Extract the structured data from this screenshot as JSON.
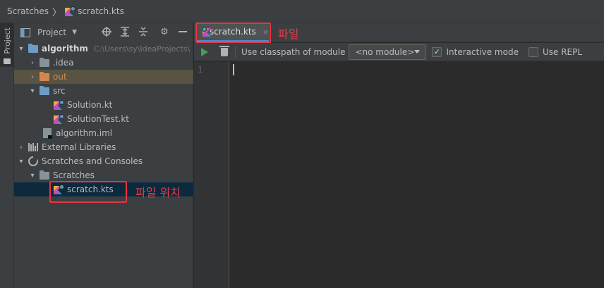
{
  "breadcrumb": {
    "root": "Scratches",
    "file": "scratch.kts"
  },
  "tool_strip": {
    "project_label": "Project"
  },
  "project_panel": {
    "title": "Project"
  },
  "tree": {
    "root_name": "algorithm",
    "root_path": "C:\\Users\\sy\\IdeaProjects\\",
    "idea": ".idea",
    "out": "out",
    "src": "src",
    "solution": "Solution.kt",
    "solution_test": "SolutionTest.kt",
    "iml": "algorithm.iml",
    "external_libraries": "External Libraries",
    "scratches_consoles": "Scratches and Consoles",
    "scratches": "Scratches",
    "scratch_file": "scratch.kts"
  },
  "editor_tab": {
    "label": "scratch.kts",
    "close": "×"
  },
  "scratch_toolbar": {
    "classpath_label": "Use classpath of module",
    "module_value": "<no module>",
    "interactive_label": "Interactive mode",
    "interactive_checked": true,
    "repl_label": "Use REPL",
    "repl_checked": false
  },
  "editor": {
    "line_number": "1"
  },
  "annotations": {
    "file": "파일",
    "file_location": "파일 위치"
  },
  "colors": {
    "annotation_red": "#e8343f",
    "selection_bg": "#0d293e",
    "excluded_folder": "#d0884f",
    "run_green": "#499c54"
  }
}
